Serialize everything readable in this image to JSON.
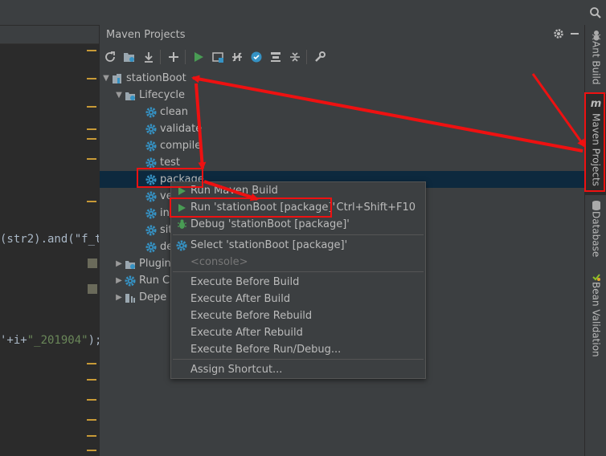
{
  "panel": {
    "title": "Maven Projects"
  },
  "toolbar": {
    "buttons": [
      "reimport-icon",
      "generate-sources-icon",
      "download-icon",
      "add-icon",
      "run-icon",
      "execute-goal-icon",
      "toggle-offline-icon",
      "skip-tests-icon",
      "show-dependencies-icon",
      "collapse-all-icon",
      "settings-wrench-icon"
    ]
  },
  "editor": {
    "line1": "(str2).and(\"f_t",
    "line2_a": "'+i+",
    "line2_b": "\"_201904\"",
    "line2_c": ");"
  },
  "tree": {
    "project": "stationBoot",
    "lifecycle": "Lifecycle",
    "goals": [
      "clean",
      "validate",
      "compile",
      "test",
      "package",
      "ve",
      "ins",
      "sit",
      "de"
    ],
    "plugins": "Plugin",
    "run_configs": "Run C",
    "dependencies": "Depe"
  },
  "context_menu": {
    "run_build": "Run Maven Build",
    "run_package": "Run 'stationBoot [package]'",
    "run_shortcut": "Ctrl+Shift+F10",
    "debug_package": "Debug 'stationBoot [package]'",
    "select_package": "Select 'stationBoot [package]'",
    "console": "<console>",
    "before_build": "Execute Before Build",
    "after_build": "Execute After Build",
    "before_rebuild": "Execute Before Rebuild",
    "after_rebuild": "Execute After Rebuild",
    "before_run": "Execute Before Run/Debug...",
    "assign_shortcut": "Assign Shortcut..."
  },
  "right_strip": {
    "ant_build": "Ant Build",
    "maven_projects": "Maven Projects",
    "database": "Database",
    "bean_validation": "Bean Validation"
  },
  "colors": {
    "annotation": "#ee1111",
    "selection": "#0d293e",
    "gear": "#3592c4",
    "run": "#499c54"
  }
}
